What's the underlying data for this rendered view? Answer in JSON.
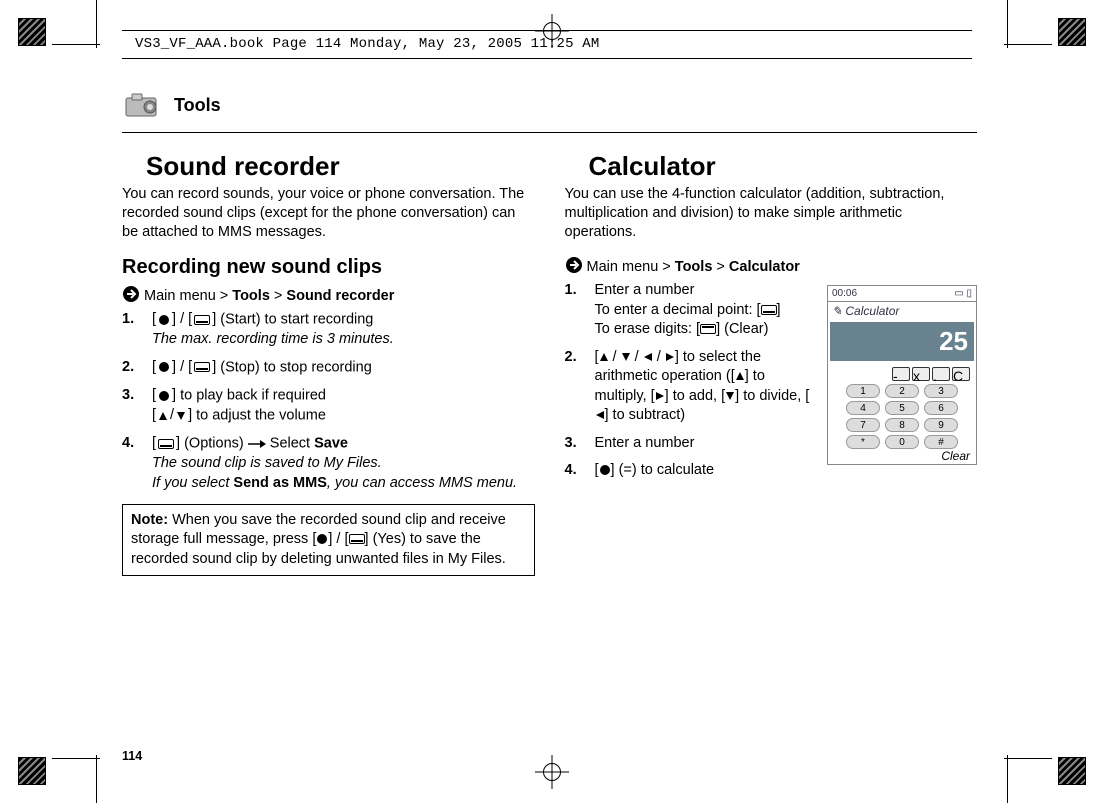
{
  "running_head": "VS3_VF_AAA.book  Page 114  Monday, May 23, 2005  11:25 AM",
  "section": {
    "title": "Tools"
  },
  "page_number": "114",
  "left": {
    "title": "Sound recorder",
    "lead": "You can record sounds, your voice or phone conversation. The recorded sound clips (except for the phone conversation) can be attached to MMS messages.",
    "sub": "Recording new sound clips",
    "nav_prefix": "Main menu > ",
    "nav_bold1": "Tools",
    "nav_sep": " > ",
    "nav_bold2": "Sound recorder",
    "step1_tail": " (Start) to start recording",
    "step1_italic": "The max. recording time is 3 minutes.",
    "step2_tail": " (Stop) to stop recording",
    "step3_tail": " to play back if required",
    "step3_line2_tail": " to adjust the volume",
    "step4_options": " (Options) ",
    "step4_select": " Select ",
    "step4_save": "Save",
    "step4_italic1": "The sound clip is saved to My Files.",
    "step4_italic2_pre": "If you select ",
    "step4_italic2_bold": "Send as MMS",
    "step4_italic2_post": ", you can access MMS menu.",
    "note_label": "Note:",
    "note_pre": "  When you save the recorded sound clip and receive storage full message, press [",
    "note_mid": "] / [",
    "note_post": "] (Yes) to save the recorded sound clip by deleting unwanted files in My Files."
  },
  "right": {
    "title": "Calculator",
    "lead": "You can use the 4-function calculator (addition, subtraction, multiplication and division) to make simple arithmetic operations.",
    "nav_prefix": "Main menu > ",
    "nav_bold1": "Tools",
    "nav_sep": " > ",
    "nav_bold2": "Calculator",
    "step1_l1": "Enter a number",
    "step1_l2_pre": "To enter a decimal point: [",
    "step1_l2_post": "]",
    "step1_l3_pre": "To erase digits: [",
    "step1_l3_post": "] (Clear)",
    "step2_pre": "[",
    "step2_mid1": " / ",
    "step2_mid2": " / ",
    "step2_mid3": " / ",
    "step2_post1": "] to select the arithmetic operation ([",
    "step2_post2": "] to multiply, [",
    "step2_post3": "] to add, [",
    "step2_post4": "] to divide, [",
    "step2_post5": "] to subtract)",
    "step3": "Enter a number",
    "step4_pre": "[",
    "step4_post": "] (=) to calculate",
    "fig": {
      "status_left": "00:06",
      "title": "Calculator",
      "display": "25",
      "keys_rows": [
        [
          "-",
          "x",
          ".",
          "C"
        ],
        [
          "1",
          "2",
          "3"
        ],
        [
          "4",
          "5",
          "6"
        ],
        [
          "7",
          "8",
          "9"
        ],
        [
          "*",
          "0",
          "#"
        ]
      ],
      "softkey_right": "Clear"
    }
  }
}
